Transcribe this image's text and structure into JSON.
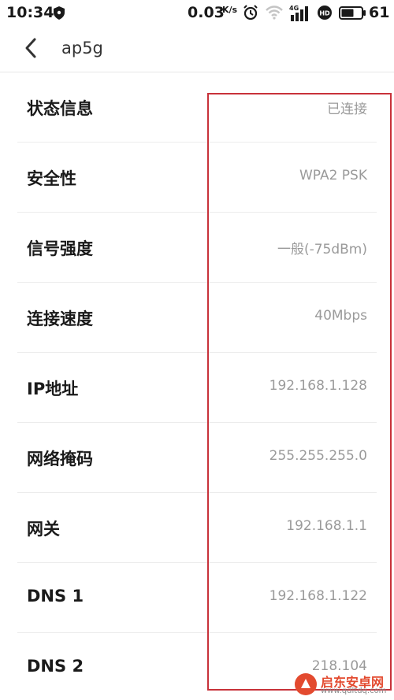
{
  "status_bar": {
    "time": "10:34",
    "net_speed": "0.03",
    "net_speed_unit": "K/s",
    "signal_label": "4G",
    "battery_level": "61",
    "icons": [
      "shield-icon",
      "alarm-icon",
      "wifi-icon",
      "signal-icon",
      "hd-icon",
      "battery-icon"
    ]
  },
  "header": {
    "title": "ap5g",
    "back_icon": "chevron-left-icon"
  },
  "rows": [
    {
      "label": "状态信息",
      "value": "已连接"
    },
    {
      "label": "安全性",
      "value": "WPA2 PSK"
    },
    {
      "label": "信号强度",
      "value": "一般(-75dBm)"
    },
    {
      "label": "连接速度",
      "value": "40Mbps"
    },
    {
      "label": "IP地址",
      "value": "192.168.1.128"
    },
    {
      "label": "网络掩码",
      "value": "255.255.255.0"
    },
    {
      "label": "网关",
      "value": "192.168.1.1"
    },
    {
      "label": "DNS 1",
      "value": "192.168.1.122"
    },
    {
      "label": "DNS 2",
      "value": "218.104"
    }
  ],
  "watermark": {
    "title": "启东安卓网",
    "url": "www.qdltdq.com"
  },
  "colors": {
    "highlight": "#c8323a",
    "value_text": "#9a9a9a",
    "watermark_accent": "#e34a2f"
  }
}
